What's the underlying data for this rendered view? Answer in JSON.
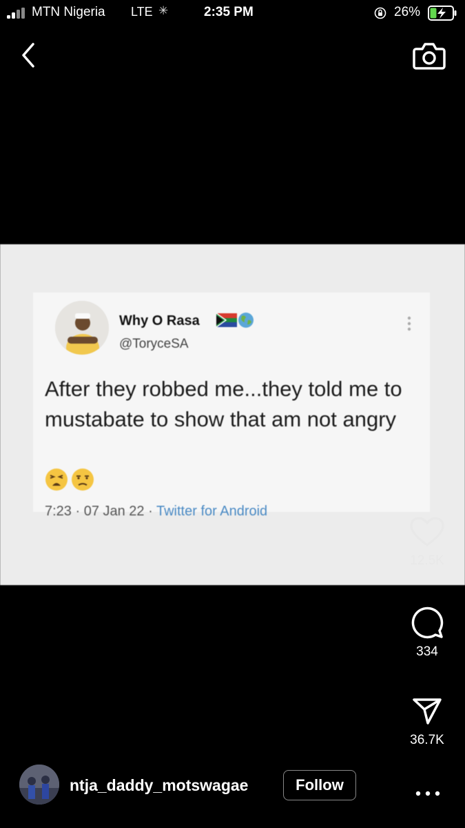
{
  "status_bar": {
    "carrier": "MTN Nigeria",
    "network": "LTE",
    "time": "2:35 PM",
    "battery": "26%",
    "icons": [
      "signal-icon",
      "loading-icon",
      "orientation-lock-icon",
      "battery-charging-icon"
    ]
  },
  "header": {
    "icons": [
      "back-icon",
      "camera-icon"
    ]
  },
  "tweet": {
    "name": "Why O Rasa",
    "handle": "@ToryceSA",
    "text": "After they robbed me...they told me to mustabate to show that am not angry",
    "meta_date": "7:23 · 07 Jan 22 ·",
    "meta_source": "Twitter for Android",
    "icons": [
      "south-africa-flag-icon",
      "globe-icon",
      "more-vertical-icon",
      "tired-face-emoji-icon",
      "unamused-face-emoji-icon"
    ]
  },
  "actions": {
    "likes": "12.5K",
    "comments": "334",
    "shares": "36.7K",
    "icons": [
      "heart-icon",
      "comment-icon",
      "send-icon"
    ]
  },
  "footer": {
    "username": "ntja_daddy_motswagae",
    "follow_label": "Follow",
    "icons": [
      "more-horizontal-icon"
    ]
  },
  "colors": {
    "background": "#000000",
    "tweet_link": "#4a8ac4",
    "battery_charging": "#62d84e"
  }
}
